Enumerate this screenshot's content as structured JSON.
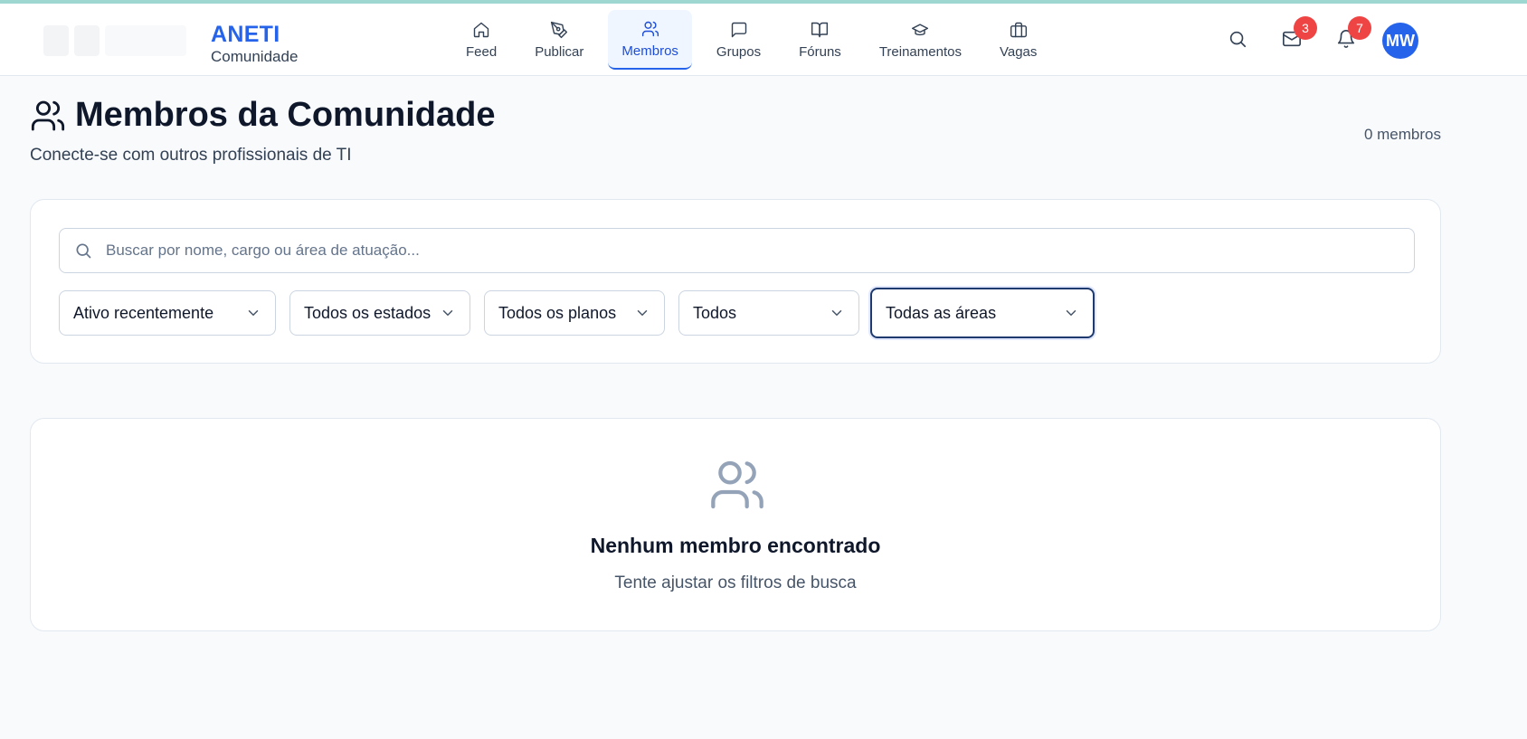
{
  "brand": {
    "name": "ANETI",
    "subtitle": "Comunidade"
  },
  "nav": {
    "items": [
      {
        "label": "Feed",
        "icon": "home-icon"
      },
      {
        "label": "Publicar",
        "icon": "pen-icon"
      },
      {
        "label": "Membros",
        "icon": "users-icon",
        "active": true
      },
      {
        "label": "Grupos",
        "icon": "message-square-icon"
      },
      {
        "label": "Fóruns",
        "icon": "book-open-icon"
      },
      {
        "label": "Treinamentos",
        "icon": "graduation-cap-icon"
      },
      {
        "label": "Vagas",
        "icon": "briefcase-icon"
      }
    ]
  },
  "topbar": {
    "messages_badge": "3",
    "notifications_badge": "7",
    "avatar_initials": "MW"
  },
  "page": {
    "title": "Membros da Comunidade",
    "subtitle": "Conecte-se com outros profissionais de TI",
    "member_count": "0 membros"
  },
  "filters": {
    "search_placeholder": "Buscar por nome, cargo ou área de atuação...",
    "sort": "Ativo recentemente",
    "state": "Todos os estados",
    "plan": "Todos os planos",
    "type": "Todos",
    "area": "Todas as áreas"
  },
  "empty": {
    "title": "Nenhum membro encontrado",
    "subtitle": "Tente ajustar os filtros de busca"
  },
  "colors": {
    "accent": "#2563eb",
    "badge": "#ef4444",
    "background": "#f8fafc"
  }
}
